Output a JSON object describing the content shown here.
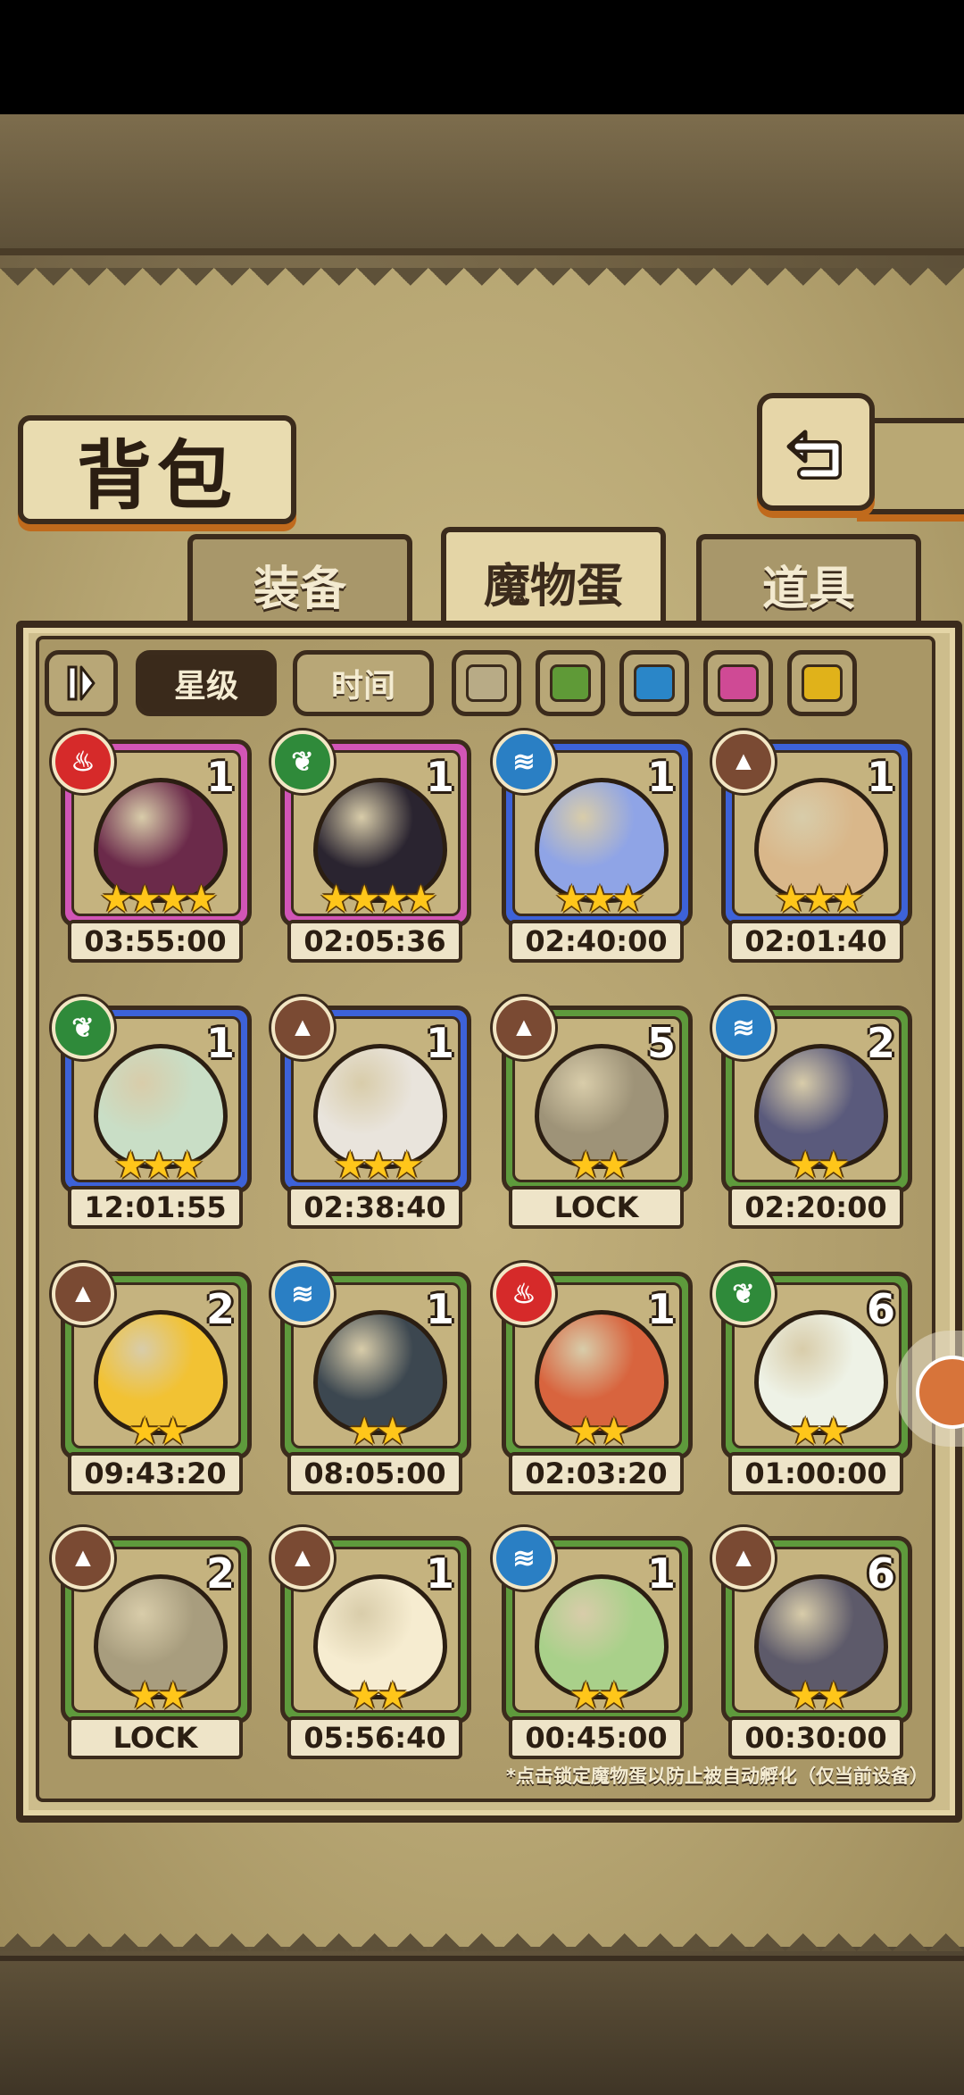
{
  "title": "背包",
  "tabs": [
    "装备",
    "魔物蛋",
    "道具"
  ],
  "active_tab": "魔物蛋",
  "sort": {
    "star": "星级",
    "time": "时间"
  },
  "filters": [
    "#b8ab86",
    "#5f9a37",
    "#2a86c8",
    "#cf4a95",
    "#e0b21a"
  ],
  "eggs": [
    {
      "element": "fire",
      "count": "1",
      "stars": "★★★★",
      "timer": "03:55:00",
      "rarity": "pink",
      "color": "#6b2a4a"
    },
    {
      "element": "leaf",
      "count": "1",
      "stars": "★★★★",
      "timer": "02:05:36",
      "rarity": "pink",
      "color": "#2a2430"
    },
    {
      "element": "water",
      "count": "1",
      "stars": "★★★",
      "timer": "02:40:00",
      "rarity": "blue",
      "color": "#8fa4e6"
    },
    {
      "element": "earth",
      "count": "1",
      "stars": "★★★",
      "timer": "02:01:40",
      "rarity": "blue",
      "color": "#d9b78a"
    },
    {
      "element": "leaf",
      "count": "1",
      "stars": "★★★",
      "timer": "12:01:55",
      "rarity": "blue",
      "color": "#c9dec6"
    },
    {
      "element": "earth",
      "count": "1",
      "stars": "★★★",
      "timer": "02:38:40",
      "rarity": "blue",
      "color": "#e9e4dc"
    },
    {
      "element": "earth",
      "count": "5",
      "stars": "★★",
      "timer": "LOCK",
      "rarity": "green",
      "color": "#9e9378"
    },
    {
      "element": "water",
      "count": "2",
      "stars": "★★",
      "timer": "02:20:00",
      "rarity": "green",
      "color": "#5a5a7c"
    },
    {
      "element": "earth",
      "count": "2",
      "stars": "★★",
      "timer": "09:43:20",
      "rarity": "green",
      "color": "#f2c233"
    },
    {
      "element": "water",
      "count": "1",
      "stars": "★★",
      "timer": "08:05:00",
      "rarity": "green",
      "color": "#3c4750"
    },
    {
      "element": "fire",
      "count": "1",
      "stars": "★★",
      "timer": "02:03:20",
      "rarity": "green",
      "color": "#d8643e"
    },
    {
      "element": "leaf",
      "count": "6",
      "stars": "★★",
      "timer": "01:00:00",
      "rarity": "green",
      "color": "#eef2e6"
    },
    {
      "element": "earth",
      "count": "2",
      "stars": "★★",
      "timer": "LOCK",
      "rarity": "green",
      "color": "#a89d7e"
    },
    {
      "element": "earth",
      "count": "1",
      "stars": "★★",
      "timer": "05:56:40",
      "rarity": "green",
      "color": "#f6ecd0"
    },
    {
      "element": "water",
      "count": "1",
      "stars": "★★",
      "timer": "00:45:00",
      "rarity": "green",
      "color": "#a9d08a"
    },
    {
      "element": "earth",
      "count": "6",
      "stars": "★★",
      "timer": "00:30:00",
      "rarity": "green",
      "color": "#5d5a6a"
    }
  ],
  "hint": "*点击锁定魔物蛋以防止被自动孵化（仅当前设备）"
}
